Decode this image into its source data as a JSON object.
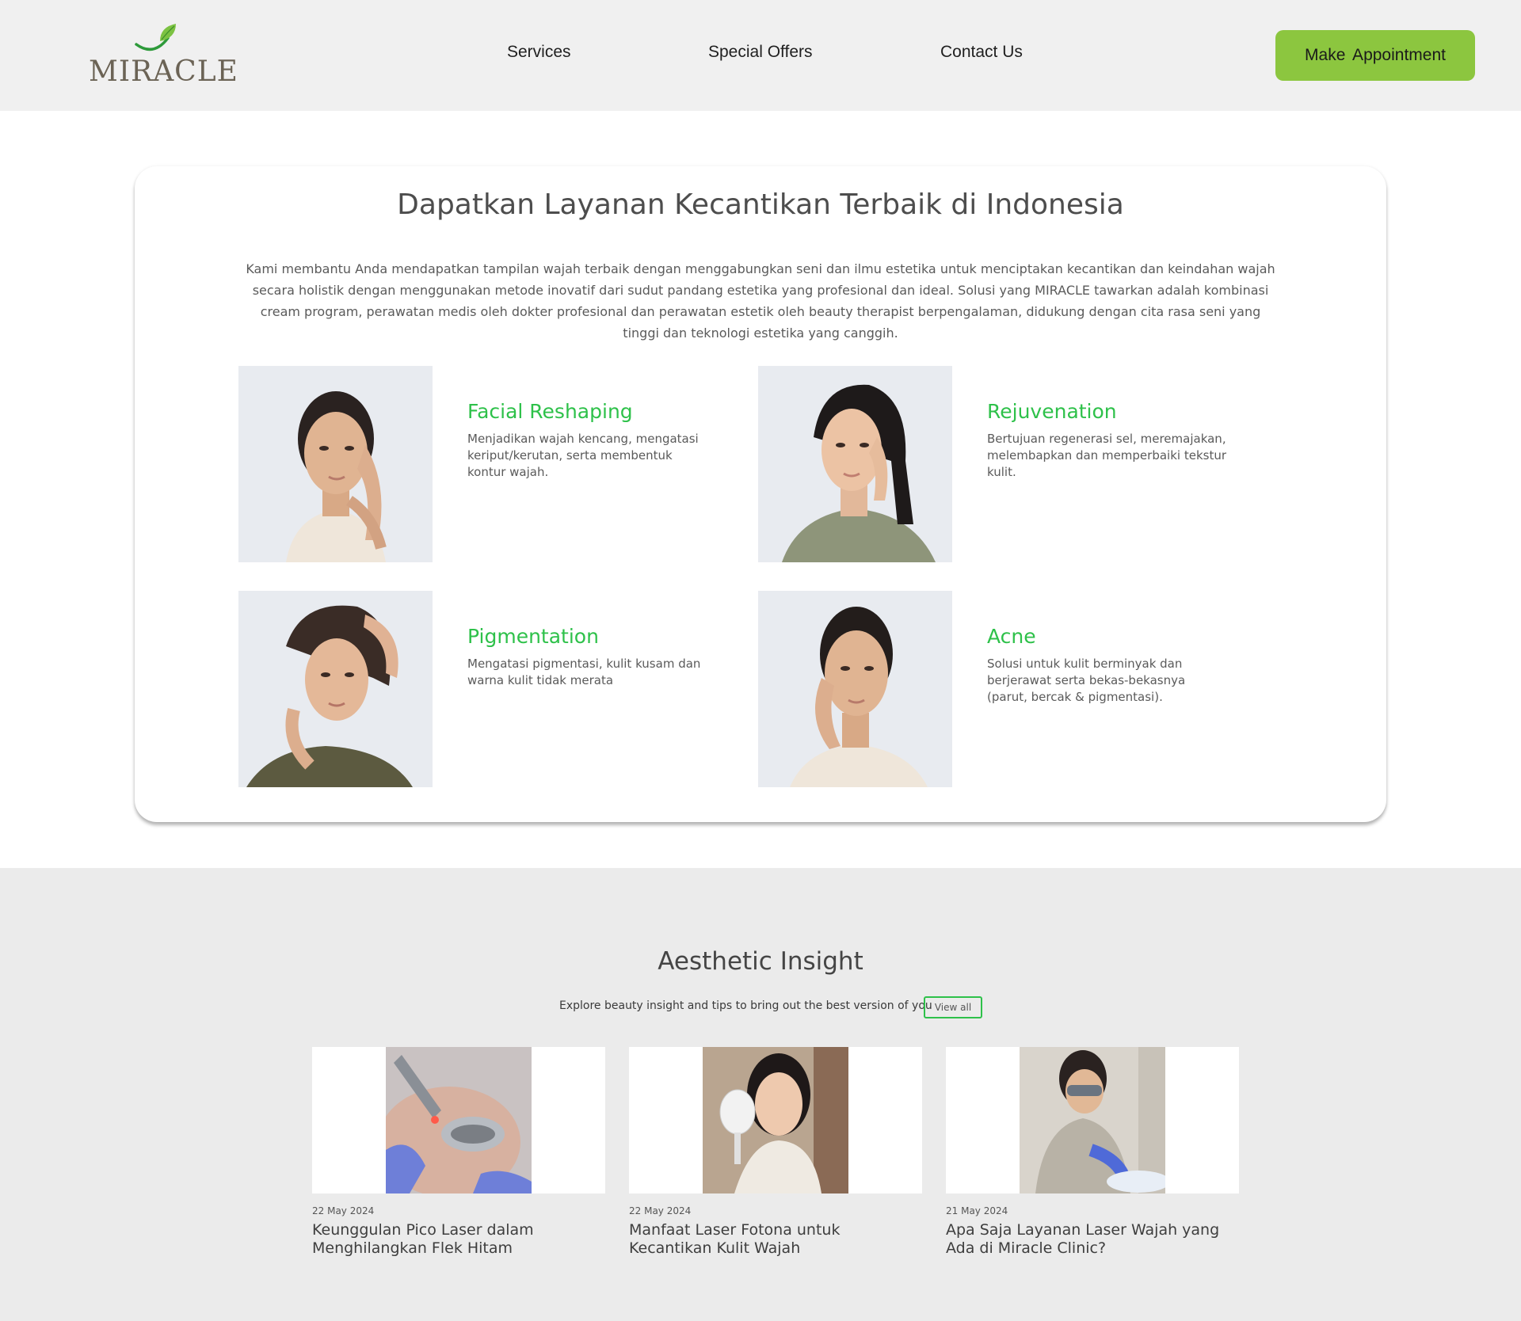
{
  "header": {
    "logo_text": "MIRACLE",
    "nav": [
      "Services",
      "Special Offers",
      "Contact Us"
    ],
    "cta_label": "Make  Appointment",
    "accent_color": "#8cc63f"
  },
  "services_section": {
    "title": "Dapatkan Layanan Kecantikan Terbaik di Indonesia",
    "description": "Kami membantu Anda mendapatkan tampilan wajah terbaik dengan menggabungkan seni dan ilmu estetika untuk menciptakan kecantikan dan keindahan wajah secara holistik dengan menggunakan metode inovatif dari sudut pandang estetika yang profesional dan ideal. Solusi yang MIRACLE tawarkan adalah kombinasi cream program, perawatan medis oleh dokter profesional dan perawatan estetik oleh beauty therapist berpengalaman, didukung dengan cita rasa seni yang tinggi dan teknologi estetika yang canggih.",
    "services": [
      {
        "name": "Facial Reshaping",
        "description": "Menjadikan wajah kencang, mengatasi keriput/kerutan, serta membentuk kontur wajah."
      },
      {
        "name": "Rejuvenation",
        "description": "Bertujuan regenerasi sel, meremajakan, melembapkan dan memperbaiki tekstur kulit."
      },
      {
        "name": "Pigmentation",
        "description": "Mengatasi pigmentasi, kulit kusam dan warna kulit tidak merata"
      },
      {
        "name": "Acne",
        "description": "Solusi untuk kulit berminyak dan berjerawat serta bekas-bekasnya (parut, bercak & pigmentasi)."
      }
    ],
    "service_title_color": "#2ec14a"
  },
  "insight_section": {
    "title": "Aesthetic Insight",
    "subtitle": "Explore beauty insight and tips to bring out the best version of you",
    "view_all_label": "View all",
    "posts": [
      {
        "date": "22 May 2024",
        "title": "Keunggulan Pico Laser dalam Menghilangkan Flek Hitam"
      },
      {
        "date": "22 May 2024",
        "title": "Manfaat Laser Fotona untuk Kecantikan Kulit Wajah"
      },
      {
        "date": "21 May 2024",
        "title": "Apa Saja Layanan Laser Wajah yang Ada di Miracle Clinic?"
      }
    ]
  }
}
